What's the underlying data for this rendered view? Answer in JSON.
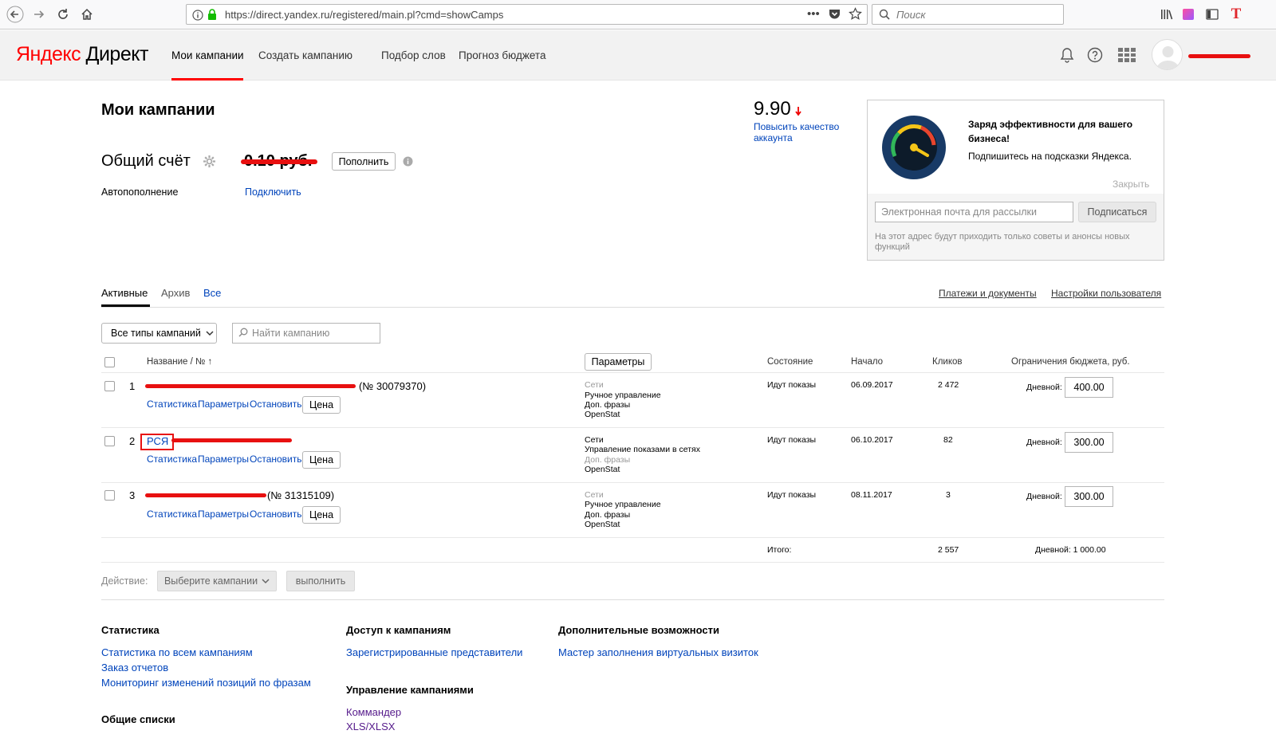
{
  "browser": {
    "url": "https://direct.yandex.ru/registered/main.pl?cmd=showCamps",
    "search_placeholder": "Поиск"
  },
  "header": {
    "logo_brand": "Яндекс",
    "logo_product": "Директ",
    "nav": [
      "Мои кампании",
      "Создать кампанию",
      "Подбор слов",
      "Прогноз бюджета"
    ]
  },
  "page": {
    "title": "Мои кампании",
    "account_label": "Общий счёт",
    "balance": "0.10 руб.",
    "refill_button": "Пополнить",
    "autorefill_label": "Автопополнение",
    "autorefill_link": "Подключить",
    "quality_score": "9.90",
    "quality_link_line1": "Повысить качество",
    "quality_link_line2": "аккаунта"
  },
  "promo": {
    "title_line1": "Заряд эффективности для вашего",
    "title_line2": "бизнеса!",
    "subtitle": "Подпишитесь на подсказки Яндекса.",
    "close": "Закрыть",
    "email_placeholder": "Электронная почта для рассылки",
    "subscribe_button": "Подписаться",
    "note_line1": "На этот адрес будут приходить только советы и анонсы новых",
    "note_line2": "функций"
  },
  "tabs": {
    "items": [
      "Активные",
      "Архив",
      "Все"
    ],
    "right_links": [
      "Платежи и документы",
      "Настройки пользователя"
    ]
  },
  "filters": {
    "type_select": "Все типы кампаний",
    "search_placeholder": "Найти кампанию"
  },
  "table": {
    "headers": {
      "name": "Название / № ↑",
      "params_button": "Параметры",
      "state": "Состояние",
      "start": "Начало",
      "clicks": "Кликов",
      "budget": "Ограничения бюджета, руб."
    },
    "row_actions": [
      "Статистика",
      "Параметры",
      "Остановить"
    ],
    "price_button": "Цена",
    "daily_label": "Дневной:",
    "rows": [
      {
        "num": "1",
        "name_tail": "(№ 30079370)",
        "params": [
          "Сети",
          "Ручное управление",
          "Доп. фразы",
          "OpenStat"
        ],
        "state": "Идут показы",
        "start": "06.09.2017",
        "clicks": "2 472",
        "budget": "400.00"
      },
      {
        "num": "2",
        "name_link": "РСЯ",
        "params": [
          "Сети",
          "Управление показами в сетях",
          "Доп. фразы",
          "OpenStat"
        ],
        "state": "Идут показы",
        "start": "06.10.2017",
        "clicks": "82",
        "budget": "300.00"
      },
      {
        "num": "3",
        "name_tail": "(№ 31315109)",
        "params": [
          "Сети",
          "Ручное управление",
          "Доп. фразы",
          "OpenStat"
        ],
        "state": "Идут показы",
        "start": "08.11.2017",
        "clicks": "3",
        "budget": "300.00"
      }
    ],
    "total_label": "Итого:",
    "total_clicks": "2 557",
    "total_budget": "Дневной: 1 000.00"
  },
  "actions": {
    "label": "Действие:",
    "select": "Выберите кампании",
    "execute": "выполнить"
  },
  "footer": {
    "stats_title": "Статистика",
    "stats_links": [
      "Статистика по всем кампаниям",
      "Заказ отчетов",
      "Мониторинг изменений позиций по фразам"
    ],
    "lists_title": "Общие списки",
    "access_title": "Доступ к кампаниям",
    "access_links": [
      "Зарегистрированные представители"
    ],
    "manage_title": "Управление кампаниями",
    "manage_links": [
      "Коммандер",
      "XLS/XLSX"
    ],
    "extra_title": "Дополнительные возможности",
    "extra_links": [
      "Мастер заполнения виртуальных визиток"
    ]
  }
}
